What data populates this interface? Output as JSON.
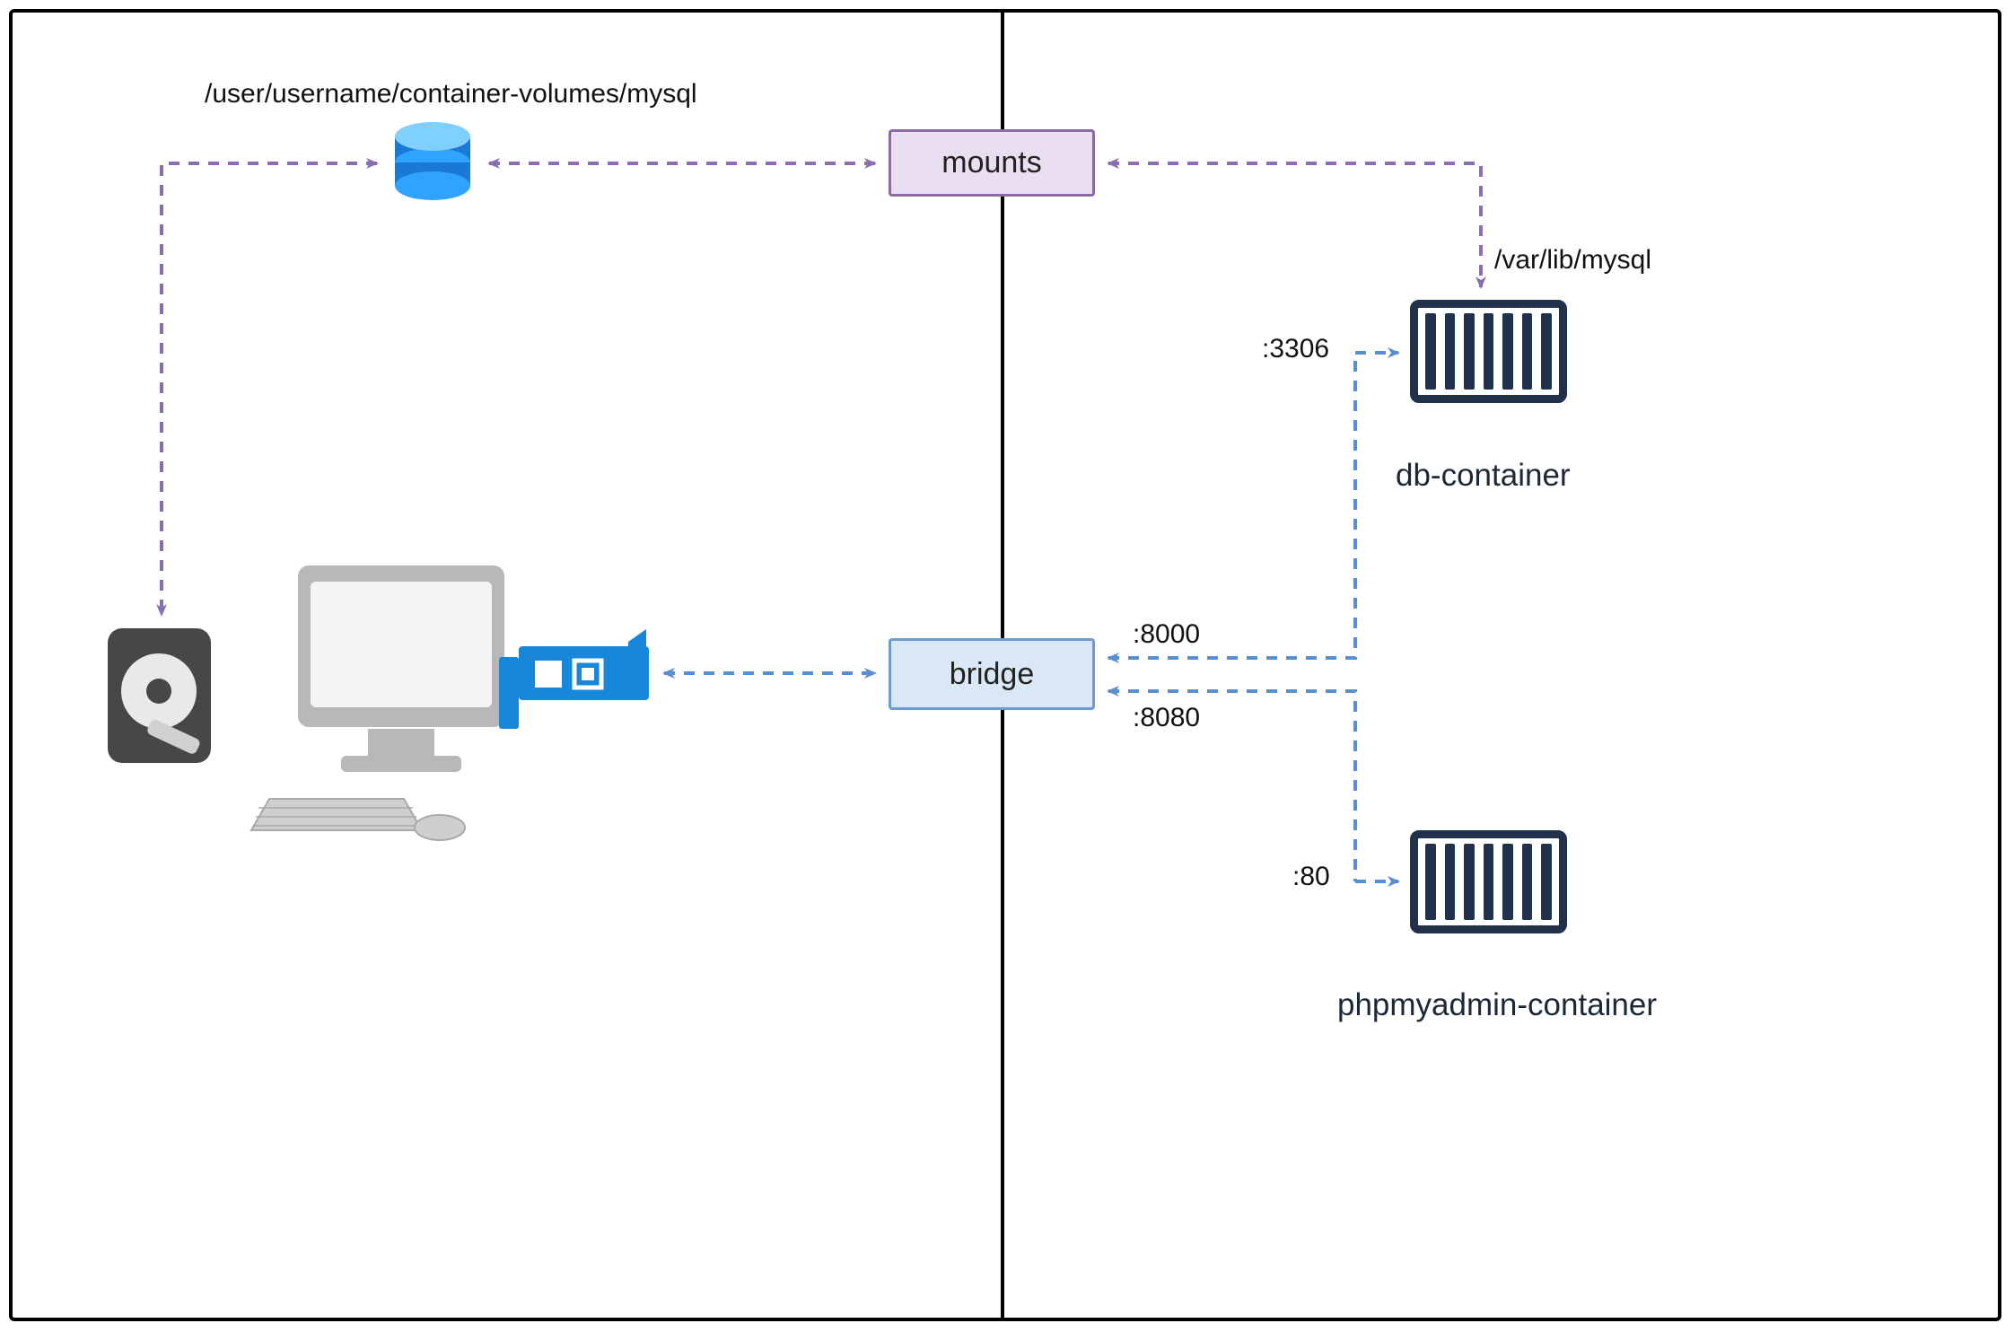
{
  "nodes": {
    "mounts": {
      "label": "mounts"
    },
    "bridge": {
      "label": "bridge"
    },
    "db": {
      "name": "db-container",
      "internal_port": ":3306",
      "mount_target": "/var/lib/mysql"
    },
    "pma": {
      "name": "phpmyadmin-container",
      "internal_port": ":80"
    }
  },
  "host": {
    "volume_path": "/user/username/container-volumes/mysql"
  },
  "bridge_ports": {
    "to_db": ":8000",
    "to_pma": ":8080"
  },
  "colors": {
    "purple": "#8a6fb0",
    "blue": "#5a8fcf",
    "darknavy": "#21314b",
    "grey": "#4a4a4a"
  }
}
